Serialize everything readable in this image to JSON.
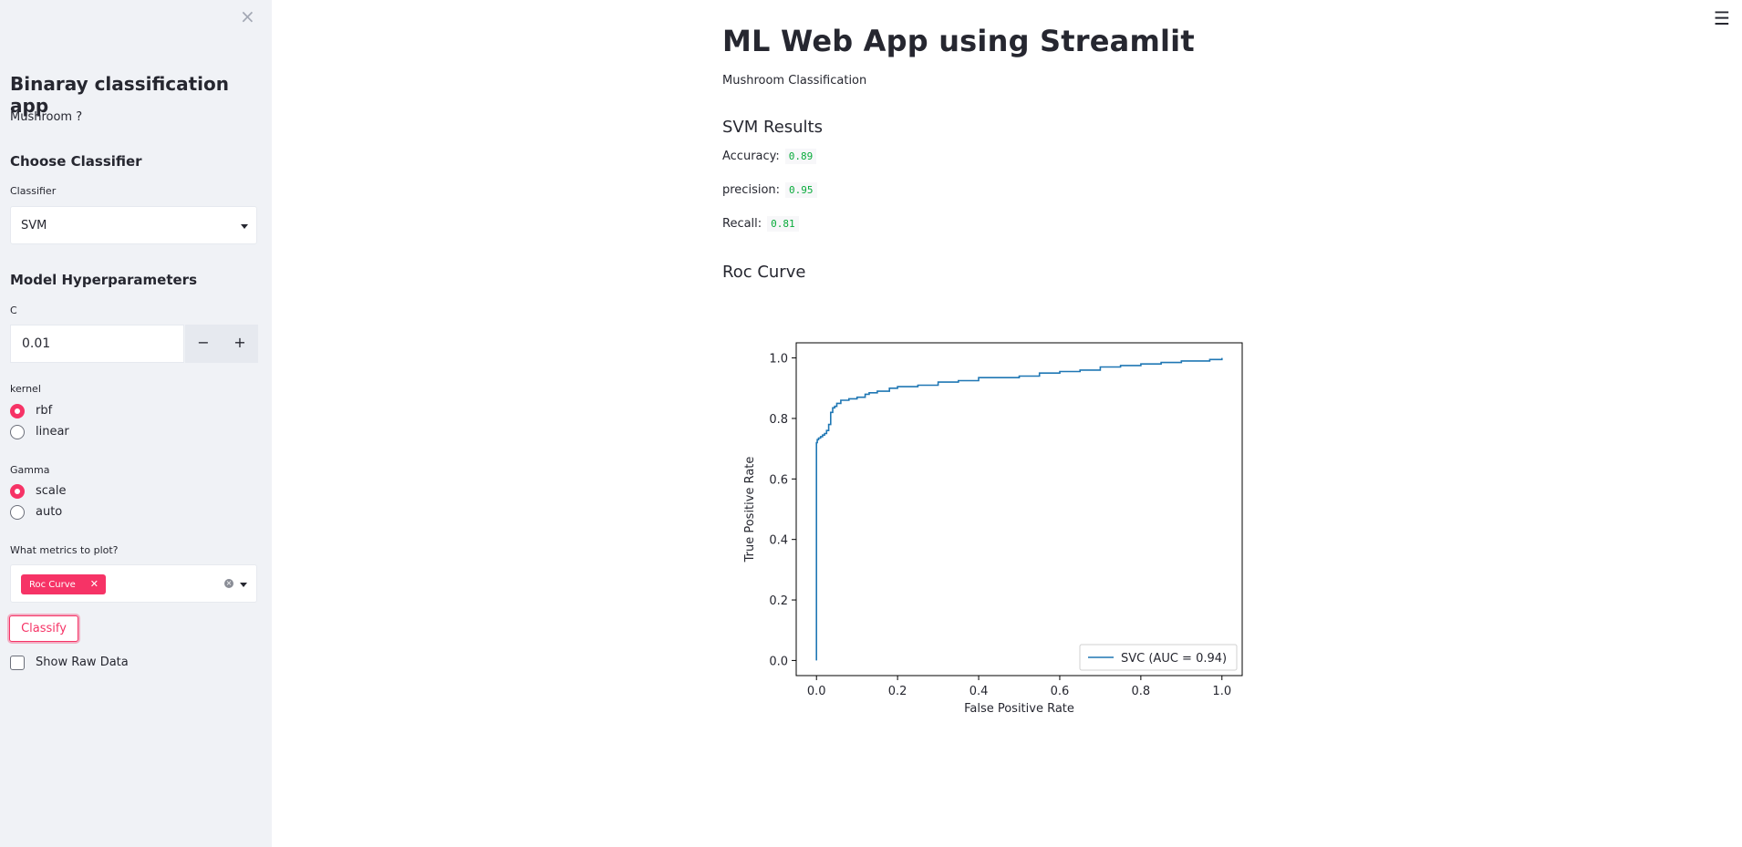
{
  "sidebar": {
    "close_glyph": "×",
    "title": "Binaray classification app",
    "subtitle": "Mushroom ?",
    "choose_classifier": "Choose Classifier",
    "classifier_label": "Classifier",
    "classifier_value": "SVM",
    "hyper_heading": "Model Hyperparameters",
    "c_label": "C",
    "c_value": "0.01",
    "minus": "−",
    "plus": "+",
    "kernel_label": "kernel",
    "kernel_options": [
      "rbf",
      "linear"
    ],
    "kernel_selected": "rbf",
    "gamma_label": "Gamma",
    "gamma_options": [
      "scale",
      "auto"
    ],
    "gamma_selected": "scale",
    "metrics_label": "What metrics to plot?",
    "metrics_selected": [
      "Roc Curve"
    ],
    "chip_remove": "✕",
    "clear_glyph": "×",
    "classify_button": "Classify",
    "show_raw_label": "Show Raw Data",
    "show_raw_checked": false
  },
  "header": {
    "menu_glyph": "☰"
  },
  "main": {
    "title": "ML Web App using Streamlit",
    "subtitle": "Mushroom Classification",
    "results_heading": "SVM Results",
    "accuracy_label": "Accuracy:",
    "accuracy_value": "0.89",
    "precision_label": "precision:",
    "precision_value": "0.95",
    "recall_label": "Recall:",
    "recall_value": "0.81",
    "roc_heading": "Roc Curve"
  },
  "colors": {
    "accent": "#f63366",
    "line": "#1f77b4",
    "code": "#09ab3b"
  },
  "chart_data": {
    "type": "line",
    "xlabel": "False Positive Rate",
    "ylabel": "True Positive Rate",
    "xlim": [
      -0.05,
      1.05
    ],
    "ylim": [
      -0.05,
      1.05
    ],
    "xticks": [
      "0.0",
      "0.2",
      "0.4",
      "0.6",
      "0.8",
      "1.0"
    ],
    "yticks": [
      "0.0",
      "0.2",
      "0.4",
      "0.6",
      "0.8",
      "1.0"
    ],
    "legend_position": "lower-right",
    "series": [
      {
        "name": "SVC (AUC = 0.94)",
        "x": [
          0.0,
          0.0,
          0.002,
          0.005,
          0.01,
          0.015,
          0.02,
          0.025,
          0.03,
          0.035,
          0.04,
          0.045,
          0.05,
          0.06,
          0.08,
          0.1,
          0.12,
          0.13,
          0.15,
          0.18,
          0.2,
          0.25,
          0.3,
          0.35,
          0.4,
          0.45,
          0.5,
          0.55,
          0.6,
          0.65,
          0.7,
          0.75,
          0.8,
          0.85,
          0.9,
          0.95,
          0.97,
          1.0
        ],
        "y": [
          0.0,
          0.72,
          0.73,
          0.735,
          0.74,
          0.745,
          0.75,
          0.76,
          0.78,
          0.82,
          0.835,
          0.84,
          0.85,
          0.86,
          0.865,
          0.87,
          0.88,
          0.885,
          0.89,
          0.9,
          0.905,
          0.91,
          0.92,
          0.925,
          0.935,
          0.935,
          0.94,
          0.95,
          0.955,
          0.96,
          0.97,
          0.975,
          0.98,
          0.985,
          0.99,
          0.99,
          0.995,
          1.0
        ]
      }
    ]
  }
}
